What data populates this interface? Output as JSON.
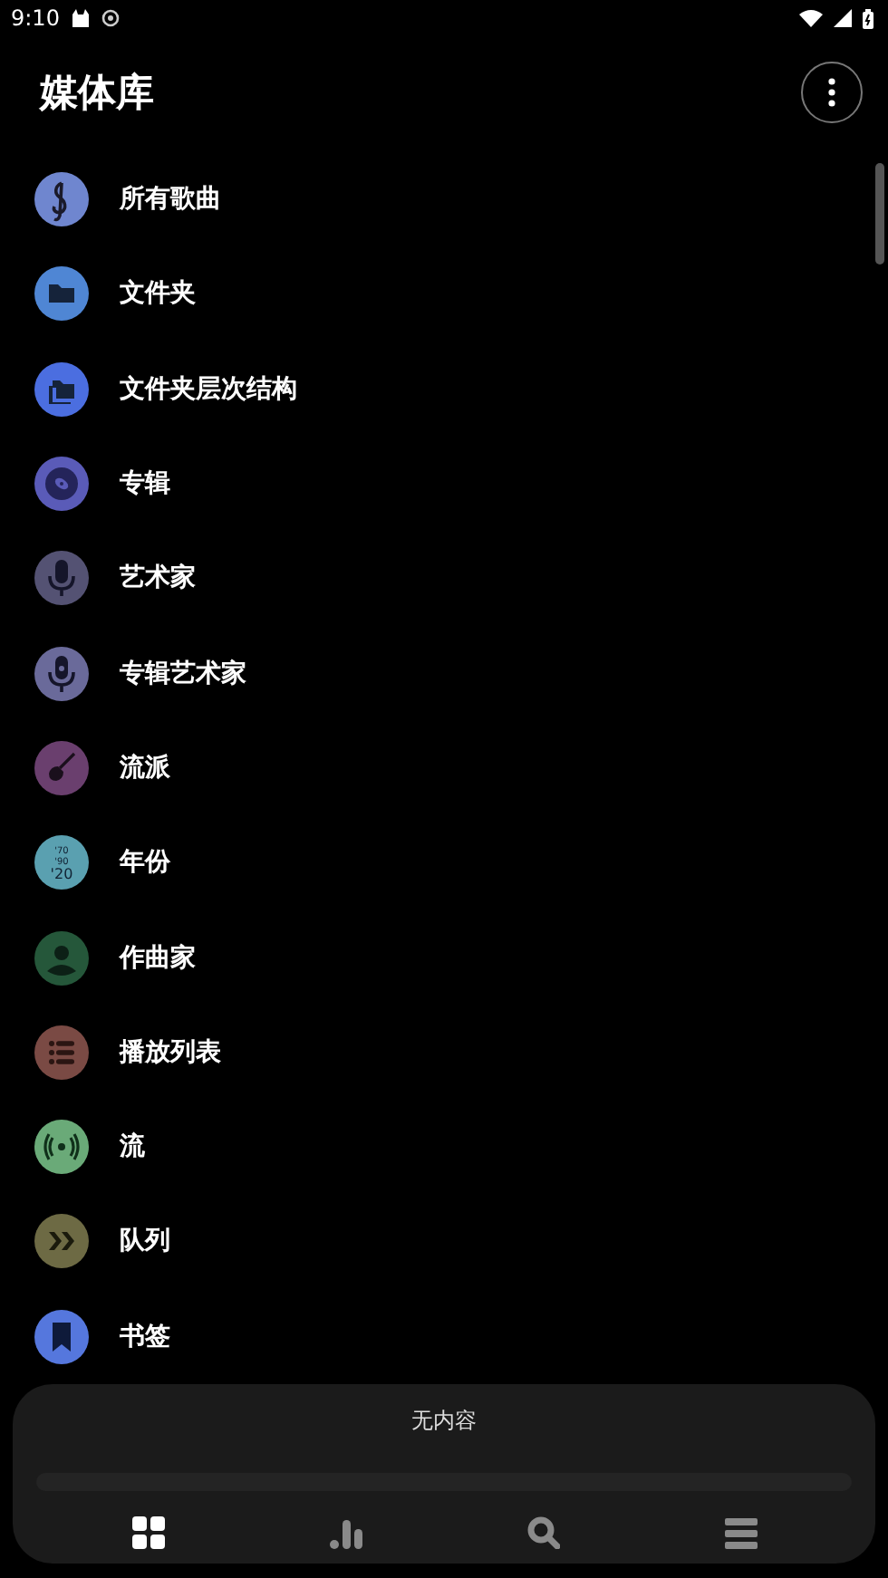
{
  "status_bar": {
    "time": "9:10"
  },
  "header": {
    "title": "媒体库"
  },
  "items": [
    {
      "label": "所有歌曲",
      "kind": "music",
      "color": "#6f86cf"
    },
    {
      "label": "文件夹",
      "kind": "folder",
      "color": "#4f86d4"
    },
    {
      "label": "文件夹层次结构",
      "kind": "folders",
      "color": "#4b6ee0"
    },
    {
      "label": "专辑",
      "kind": "disc",
      "color": "#5a5bb8"
    },
    {
      "label": "艺术家",
      "kind": "mic",
      "color": "#545273"
    },
    {
      "label": "专辑艺术家",
      "kind": "mic2",
      "color": "#6a6a9a"
    },
    {
      "label": "流派",
      "kind": "guitar",
      "color": "#6a3f6e"
    },
    {
      "label": "年份",
      "kind": "years",
      "color": "#5aa0b0",
      "icon_text": [
        "'70",
        "'90",
        "'20"
      ]
    },
    {
      "label": "作曲家",
      "kind": "person",
      "color": "#25573a"
    },
    {
      "label": "播放列表",
      "kind": "list",
      "color": "#7a4a44"
    },
    {
      "label": "流",
      "kind": "stream",
      "color": "#6aaa78"
    },
    {
      "label": "队列",
      "kind": "queue",
      "color": "#6d6a44"
    },
    {
      "label": "书签",
      "kind": "bookmark",
      "color": "#5577dd"
    }
  ],
  "player": {
    "title": "无内容",
    "level": 0,
    "nav": [
      {
        "kind": "grid",
        "selected": true
      },
      {
        "kind": "bars",
        "selected": false
      },
      {
        "kind": "search",
        "selected": false
      },
      {
        "kind": "menu",
        "selected": false
      }
    ]
  }
}
